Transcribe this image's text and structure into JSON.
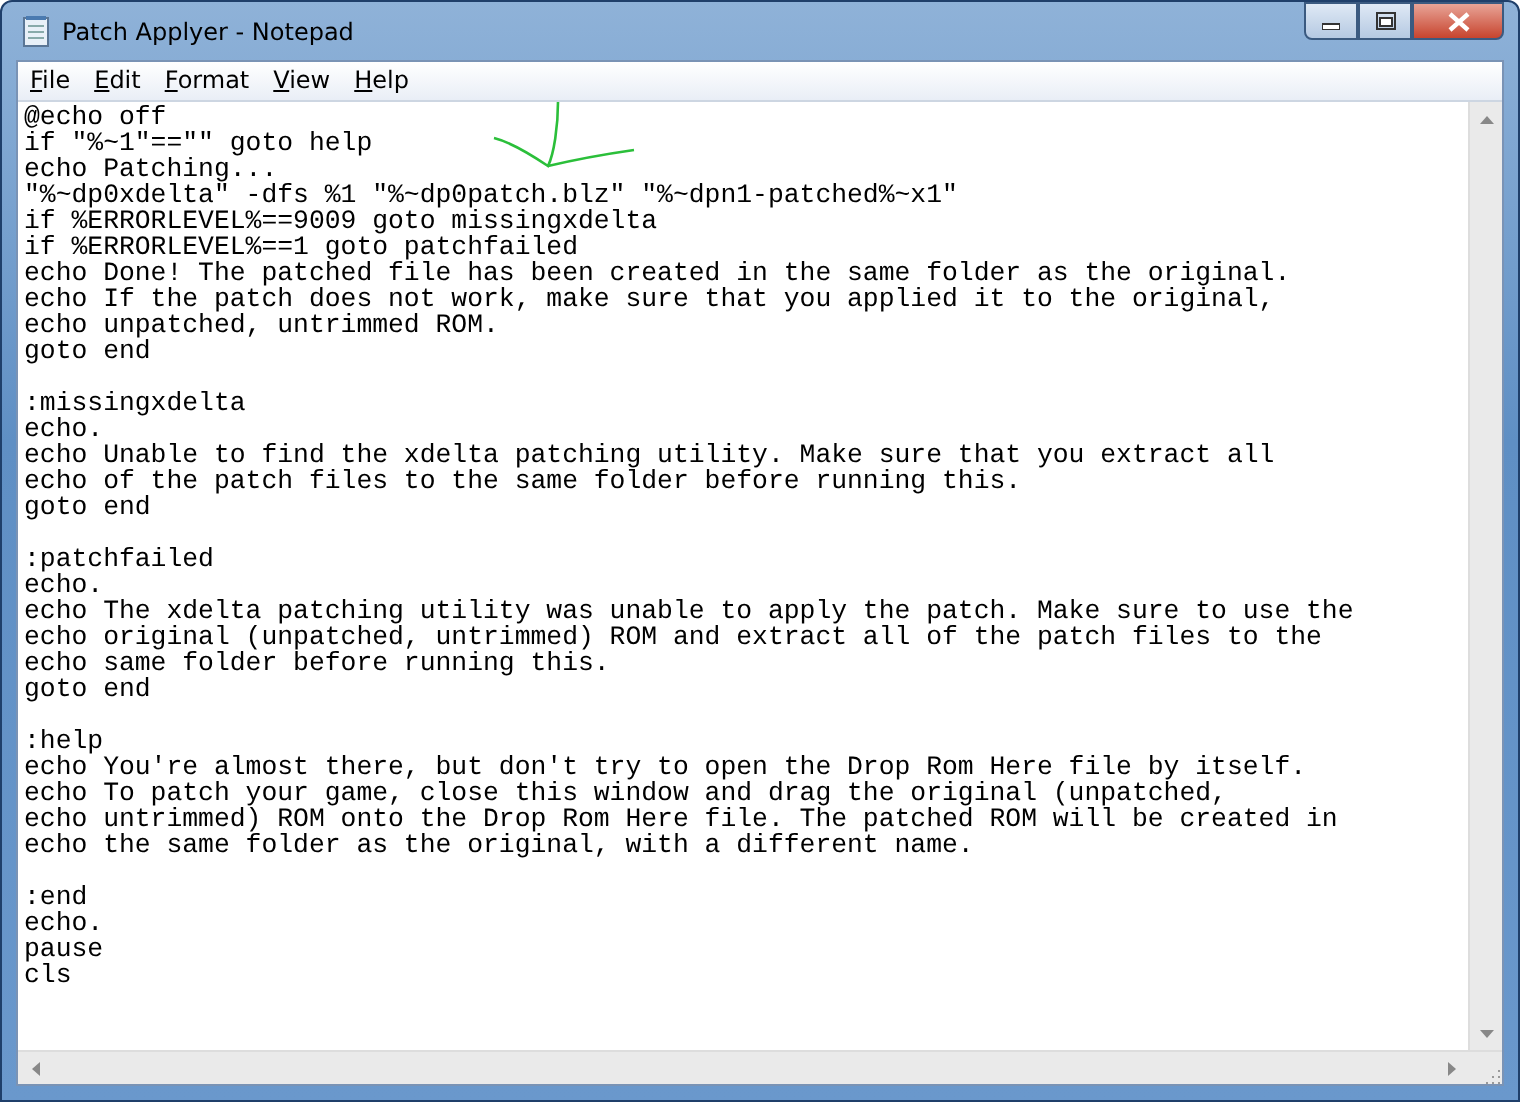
{
  "window": {
    "title": "Patch Applyer - Notepad"
  },
  "menu": [
    "File",
    "Edit",
    "Format",
    "View",
    "Help"
  ],
  "blocks": [
    [
      "@echo off",
      "if \"%~1\"==\"\" goto help",
      "echo Patching...",
      "\"%~dp0xdelta\" -dfs %1 \"%~dp0patch.blz\" \"%~dpn1-patched%~x1\"",
      "if %ERRORLEVEL%==9009 goto missingxdelta",
      "if %ERRORLEVEL%==1 goto patchfailed",
      "echo Done! The patched file has been created in the same folder as the original.",
      "echo If the patch does not work, make sure that you applied it to the original,",
      "echo unpatched, untrimmed ROM.",
      "goto end"
    ],
    [
      ":missingxdelta",
      "echo.",
      "echo Unable to find the xdelta patching utility. Make sure that you extract all",
      "echo of the patch files to the same folder before running this.",
      "goto end"
    ],
    [
      ":patchfailed",
      "echo.",
      "echo The xdelta patching utility was unable to apply the patch. Make sure to use the",
      "echo original (unpatched, untrimmed) ROM and extract all of the patch files to the",
      "echo same folder before running this.",
      "goto end"
    ],
    [
      ":help",
      "echo You're almost there, but don't try to open the Drop Rom Here file by itself.",
      "echo To patch your game, close this window and drag the original (unpatched,",
      "echo untrimmed) ROM onto the Drop Rom Here file. The patched ROM will be created in",
      "echo the same folder as the original, with a different name."
    ],
    [
      ":end",
      "echo.",
      "pause",
      "cls"
    ]
  ]
}
